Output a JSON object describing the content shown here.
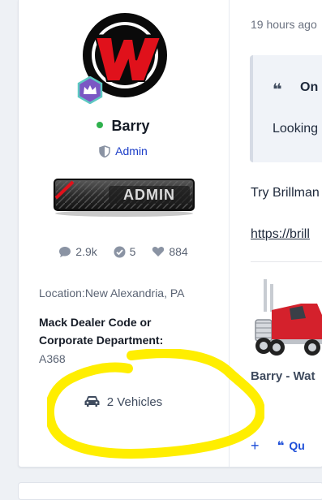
{
  "profile": {
    "name": "Barry",
    "online": true,
    "role": "Admin",
    "rank_badge_text": "ADMIN",
    "stats": {
      "messages": "2.9k",
      "solutions": "5",
      "reactions": "884"
    },
    "location": "Location:New Alexandria, PA",
    "field_label": "Mack Dealer Code or Corporate Department:",
    "field_value": "A368",
    "vehicles": "2 Vehicles"
  },
  "post": {
    "timestamp": "19 hours ago",
    "quote_author": "On",
    "quote_text": "Looking",
    "body_text": "Try Brillman",
    "link_text": "https://brill",
    "embed_title": "Barry - Wat",
    "action_quote": "Qu"
  },
  "icons": {
    "messages": "comment-icon",
    "solutions": "check-circle-icon",
    "reactions": "heart-icon",
    "role": "shield-icon",
    "vehicles": "car-icon",
    "crown": "crown-icon"
  },
  "colors": {
    "accent_blue": "#1d4ed8",
    "online": "#2fb14d",
    "badge_purple": "#7b57c4",
    "highlight": "#ffee00",
    "logo_red": "#e0111b"
  }
}
